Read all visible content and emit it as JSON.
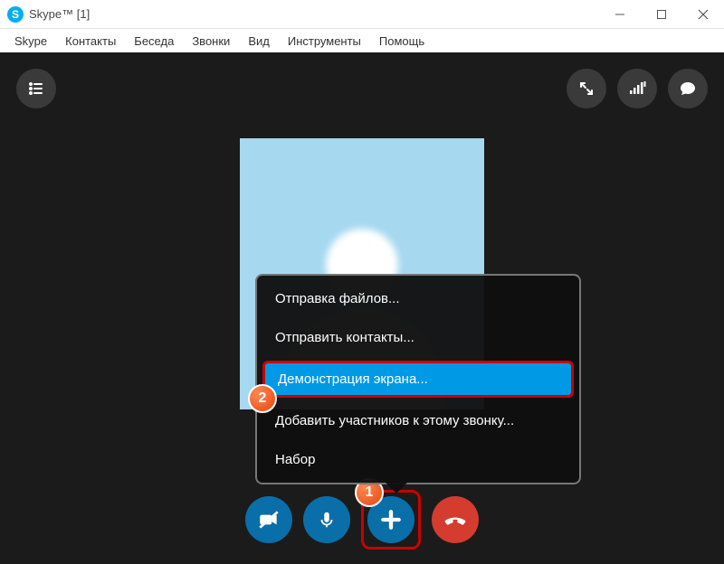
{
  "window": {
    "title": "Skype™ [1]"
  },
  "menubar": {
    "items": [
      "Skype",
      "Контакты",
      "Беседа",
      "Звонки",
      "Вид",
      "Инструменты",
      "Помощь"
    ]
  },
  "popup": {
    "items": [
      "Отправка файлов...",
      "Отправить контакты...",
      "Демонстрация экрана...",
      "Добавить участников к этому звонку...",
      "Набор"
    ],
    "highlighted_index": 2
  },
  "annotations": {
    "badge1": "1",
    "badge2": "2"
  },
  "colors": {
    "skype_blue": "#00aff0",
    "call_blue": "#0a6ea8",
    "hangup_red": "#d43c2f",
    "highlight_border": "#c00"
  }
}
